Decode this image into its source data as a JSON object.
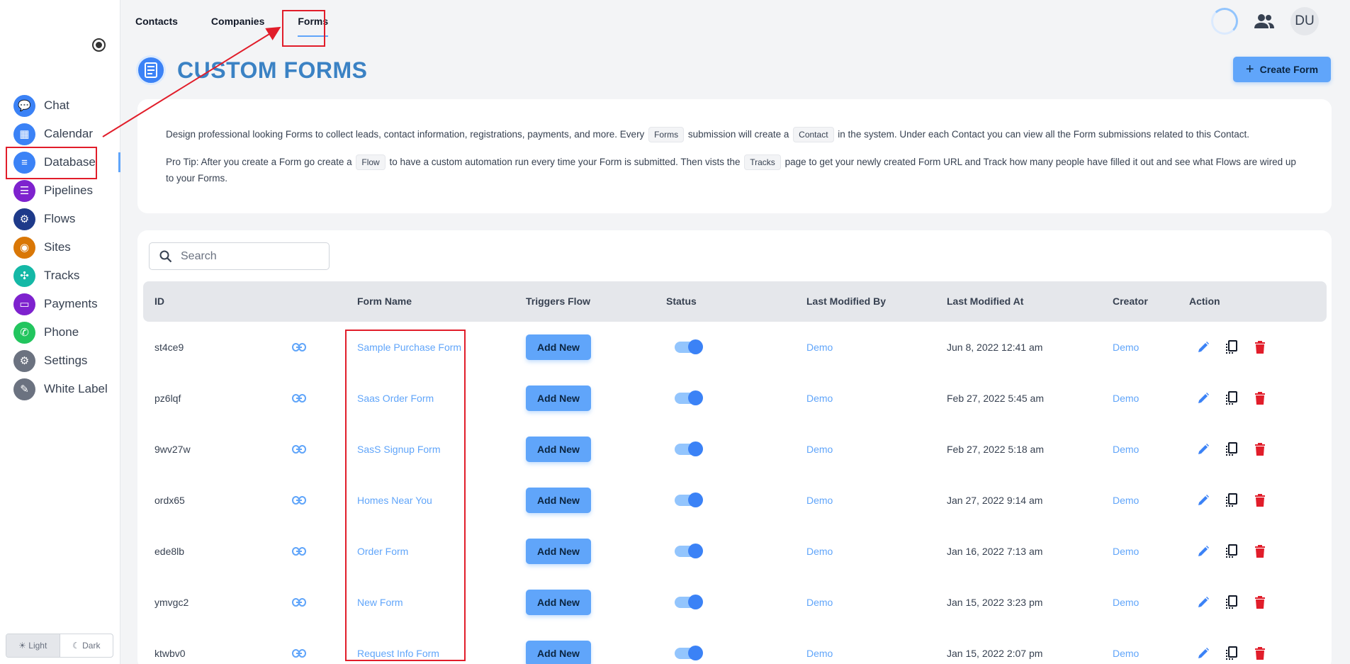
{
  "sidebar": {
    "items": [
      {
        "label": "Chat",
        "icon": "chat-icon",
        "color": "#3b82f6"
      },
      {
        "label": "Calendar",
        "icon": "calendar-icon",
        "color": "#3b82f6"
      },
      {
        "label": "Database",
        "icon": "database-icon",
        "color": "#3b82f6"
      },
      {
        "label": "Pipelines",
        "icon": "pipelines-icon",
        "color": "#7e22ce"
      },
      {
        "label": "Flows",
        "icon": "flows-icon",
        "color": "#1e3a8a"
      },
      {
        "label": "Sites",
        "icon": "sites-icon",
        "color": "#d97706"
      },
      {
        "label": "Tracks",
        "icon": "tracks-icon",
        "color": "#14b8a6"
      },
      {
        "label": "Payments",
        "icon": "payments-icon",
        "color": "#7e22ce"
      },
      {
        "label": "Phone",
        "icon": "phone-icon",
        "color": "#22c55e"
      },
      {
        "label": "Settings",
        "icon": "settings-icon",
        "color": "#6b7280"
      },
      {
        "label": "White Label",
        "icon": "white-label-icon",
        "color": "#6b7280"
      }
    ],
    "theme": {
      "light": "Light",
      "dark": "Dark"
    }
  },
  "topnav": {
    "tabs": [
      "Contacts",
      "Companies",
      "Forms"
    ]
  },
  "avatar": "DU",
  "page": {
    "title": "CUSTOM FORMS",
    "create_label": "Create Form"
  },
  "info": {
    "p1_a": "Design professional looking Forms to collect leads, contact information, registrations, payments, and more. Every",
    "chip_forms": "Forms",
    "p1_b": "submission will create a",
    "chip_contact": "Contact",
    "p1_c": "in the system. Under each Contact you can view all the Form submissions related to this Contact.",
    "p2_a": "Pro Tip: After you create a Form go create a",
    "chip_flow": "Flow",
    "p2_b": "to have a custom automation run every time your Form is submitted. Then vists the",
    "chip_tracks": "Tracks",
    "p2_c": "page to get your newly created Form URL and Track how many people have filled it out and see what Flows are wired up to your Forms."
  },
  "search": {
    "placeholder": "Search"
  },
  "table": {
    "headers": [
      "ID",
      "Form Name",
      "Triggers Flow",
      "Status",
      "Last Modified By",
      "Last Modified At",
      "Creator",
      "Action"
    ],
    "rows": [
      {
        "id": "st4ce9",
        "name": "Sample Purchase Form",
        "flow": "Add New",
        "modified_by": "Demo",
        "modified_at": "Jun 8, 2022 12:41 am",
        "creator": "Demo"
      },
      {
        "id": "pz6lqf",
        "name": "Saas Order Form",
        "flow": "Add New",
        "modified_by": "Demo",
        "modified_at": "Feb 27, 2022 5:45 am",
        "creator": "Demo"
      },
      {
        "id": "9wv27w",
        "name": "SasS Signup Form",
        "flow": "Add New",
        "modified_by": "Demo",
        "modified_at": "Feb 27, 2022 5:18 am",
        "creator": "Demo"
      },
      {
        "id": "ordx65",
        "name": "Homes Near You",
        "flow": "Add New",
        "modified_by": "Demo",
        "modified_at": "Jan 27, 2022 9:14 am",
        "creator": "Demo"
      },
      {
        "id": "ede8lb",
        "name": "Order Form",
        "flow": "Add New",
        "modified_by": "Demo",
        "modified_at": "Jan 16, 2022 7:13 am",
        "creator": "Demo"
      },
      {
        "id": "ymvgc2",
        "name": "New Form",
        "flow": "Add New",
        "modified_by": "Demo",
        "modified_at": "Jan 15, 2022 3:23 pm",
        "creator": "Demo"
      },
      {
        "id": "ktwbv0",
        "name": "Request Info Form",
        "flow": "Add New",
        "modified_by": "Demo",
        "modified_at": "Jan 15, 2022 2:07 pm",
        "creator": "Demo"
      }
    ]
  },
  "colors": {
    "accent": "#60a5fa",
    "title": "#3b82c4",
    "delete": "#e11d2a",
    "annotation": "#e11d2a"
  }
}
